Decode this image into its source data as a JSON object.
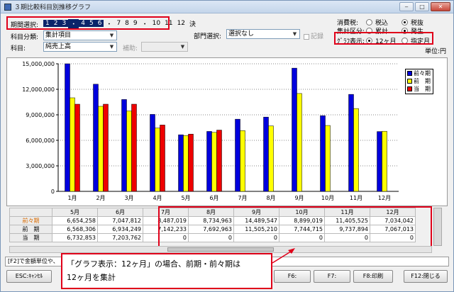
{
  "window": {
    "title": "３期比較科目別推移グラフ",
    "btn_min": "‒",
    "btn_max": "□",
    "btn_close": "✕"
  },
  "period": {
    "label": "期間選択:",
    "months": [
      "1",
      "2",
      "3",
      "・",
      "4",
      "5",
      "6",
      "・",
      "7",
      "8",
      "9",
      "・",
      "10",
      "11",
      "12",
      "決"
    ],
    "selected_count": 7
  },
  "filters": {
    "subject_class_label": "科目分類:",
    "subject_class_value": "集計項目",
    "subject_label": "科目:",
    "subject_value": "純売上高",
    "aux_label": "補助:",
    "aux_value": "",
    "dept_label": "部門選択:",
    "dept_value": "選択なし",
    "kiroku_label": "記録"
  },
  "options": {
    "tax_label": "消費税:",
    "tax_incl": "税込",
    "tax_excl": "税抜",
    "agg_label": "集計区分:",
    "agg_cumulative": "累計",
    "agg_occurrence": "発生",
    "graph_label": "ｸﾞﾗﾌ表示:",
    "graph_12m": "12ヶ月",
    "graph_specified": "指定月",
    "unit": "単位:円"
  },
  "colors": {
    "series1": "#0000dd",
    "series2": "#ffff00",
    "series3": "#ee0000",
    "highlight": "#e0001a",
    "orange_label": "#d86a00"
  },
  "chart_data": {
    "type": "bar",
    "categories": [
      "1月",
      "2月",
      "3月",
      "4月",
      "5月",
      "6月",
      "7月",
      "8月",
      "9月",
      "10月",
      "11月",
      "12月"
    ],
    "series": [
      {
        "name": "前々期",
        "values": [
          15000000,
          12600000,
          10800000,
          9050000,
          6654258,
          7047812,
          8487019,
          8734963,
          14489547,
          8899019,
          11405525,
          7034042
        ]
      },
      {
        "name": "前　期",
        "values": [
          11000000,
          10000000,
          9450000,
          7450000,
          6568306,
          6934249,
          7142233,
          7692963,
          11505210,
          7744715,
          9737894,
          7067013
        ]
      },
      {
        "name": "当　期",
        "values": [
          10250000,
          10250000,
          10250000,
          7800000,
          6732853,
          7203762,
          null,
          null,
          null,
          null,
          null,
          null
        ]
      }
    ],
    "yticks": [
      "0",
      "3,000,000",
      "6,000,000",
      "9,000,000",
      "12,000,000",
      "15,000,000"
    ],
    "ylim": [
      0,
      15000000
    ],
    "legend_position": "top-right"
  },
  "table": {
    "headers": [
      "",
      "5月",
      "6月",
      "7月",
      "8月",
      "9月",
      "10月",
      "11月",
      "12月"
    ],
    "rows": [
      {
        "label": "前々期",
        "cells": [
          "6,654,258",
          "7,047,812",
          "8,487,019",
          "8,734,963",
          "14,489,547",
          "8,899,019",
          "11,405,525",
          "7,034,042"
        ]
      },
      {
        "label": "前　期",
        "cells": [
          "6,568,306",
          "6,934,249",
          "7,142,233",
          "7,692,963",
          "11,505,210",
          "7,744,715",
          "9,737,894",
          "7,067,013"
        ]
      },
      {
        "label": "当　期",
        "cells": [
          "6,732,853",
          "7,203,762",
          "0",
          "0",
          "0",
          "0",
          "0",
          "0"
        ]
      }
    ]
  },
  "status": "[F2]で金額単位や、",
  "buttons": {
    "esc": "ESC:ｷｬﾝｾﾙ",
    "f6": "F6:",
    "f7": "F7:",
    "f8": "F8:印刷",
    "f12": "F12:閉じる"
  },
  "callout": {
    "line1": "「グラフ表示：12ヶ月」の場合、前期・前々期は",
    "line2": "12ヶ月を集計"
  }
}
